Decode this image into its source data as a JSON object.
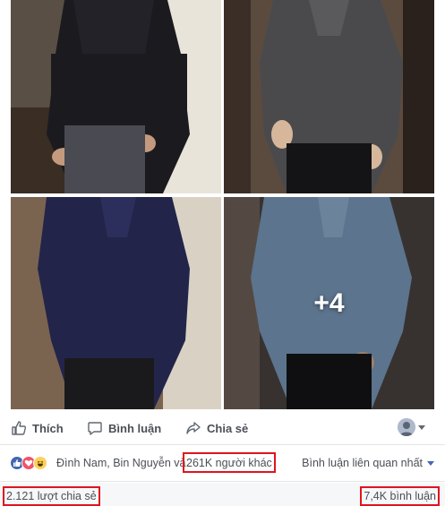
{
  "gallery": {
    "photos": [
      {
        "icon": "black-shirt-photo"
      },
      {
        "icon": "grey-shirt-photo"
      },
      {
        "icon": "navy-shirt-photo"
      },
      {
        "icon": "light-blue-shirt-photo"
      }
    ],
    "more_count": "+4"
  },
  "actions": {
    "like_label": "Thích",
    "comment_label": "Bình luận",
    "share_label": "Chia sẻ"
  },
  "reactions": {
    "icons": [
      "like-reaction-icon",
      "love-reaction-icon",
      "haha-reaction-icon"
    ],
    "names_text": "Đình Nam, Bin Nguyễn và",
    "others_text": "261K người khác",
    "sort_label": "Bình luận liên quan nhất"
  },
  "stats": {
    "shares_text": "2.121 lượt chia sẻ",
    "comments_text": "7,4K bình luận"
  },
  "colors": {
    "highlight_box": "#e0141e",
    "facebook_blue": "#4267b2",
    "action_text": "#4b4f56"
  }
}
